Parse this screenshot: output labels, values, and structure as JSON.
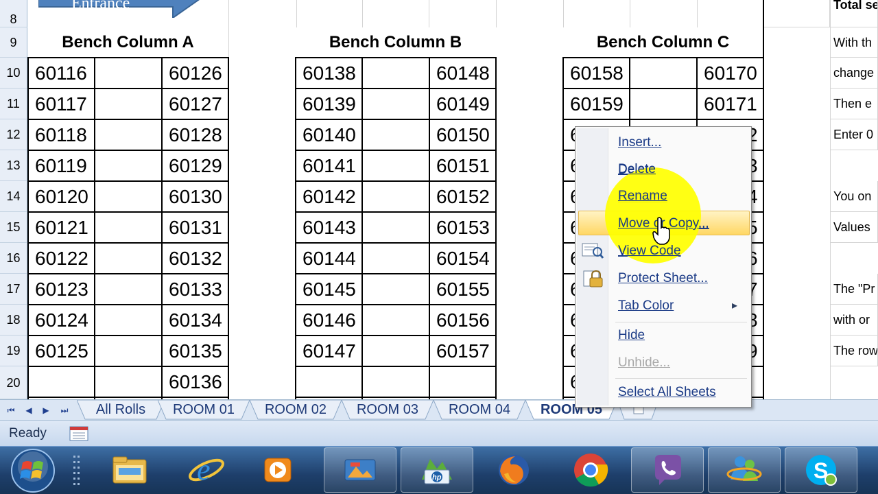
{
  "sheet": {
    "entrance_label": "Entrance",
    "row_numbers": [
      "8",
      "9",
      "10",
      "11",
      "12",
      "13",
      "14",
      "15",
      "16",
      "17",
      "18",
      "19",
      "20"
    ],
    "headers": {
      "a": "Bench Column A",
      "b": "Bench Column B",
      "c": "Bench Column C"
    },
    "col_a_left": [
      "60116",
      "60117",
      "60118",
      "60119",
      "60120",
      "60121",
      "60122",
      "60123",
      "60124",
      "60125",
      ""
    ],
    "col_a_right": [
      "60126",
      "60127",
      "60128",
      "60129",
      "60130",
      "60131",
      "60132",
      "60133",
      "60134",
      "60135",
      "60136"
    ],
    "col_b_left": [
      "60138",
      "60139",
      "60140",
      "60141",
      "60142",
      "60143",
      "60144",
      "60145",
      "60146",
      "60147",
      ""
    ],
    "col_b_right": [
      "60148",
      "60149",
      "60150",
      "60151",
      "60152",
      "60153",
      "60154",
      "60155",
      "60156",
      "60157",
      ""
    ],
    "col_c_left": [
      "60158",
      "60159",
      "6",
      "6",
      "6",
      "6",
      "6",
      "6",
      "6",
      "6",
      "6"
    ],
    "col_c_right": [
      "60170",
      "60171",
      "2",
      "3",
      "4",
      "5",
      "6",
      "7",
      "8",
      "9",
      ""
    ],
    "notes": {
      "r8": "Total se",
      "r9": "With th",
      "r10": "change",
      "r11": "Then e",
      "r12": "Enter 0",
      "r14": "You on",
      "r15": "Values",
      "r17": "The \"Pr",
      "r18": "with or",
      "r19": "The row"
    }
  },
  "tabs": {
    "nav": [
      "⏮",
      "◀",
      "▶",
      "⏭"
    ],
    "items": [
      "All Rolls",
      "ROOM 01",
      "ROOM 02",
      "ROOM 03",
      "ROOM 04",
      "ROOM 05"
    ],
    "active": "ROOM 05"
  },
  "status": {
    "text": "Ready"
  },
  "context_menu": {
    "items": [
      "Insert...",
      "Delete",
      "Rename",
      "Move or Copy...",
      "View Code",
      "Protect Sheet...",
      "Tab Color",
      "Hide",
      "Unhide...",
      "Select All Sheets"
    ],
    "highlighted": "Move or Copy...",
    "disabled": "Unhide...",
    "submenu_arrow": "▸"
  },
  "taskbar": {
    "apps": [
      "file-explorer-icon",
      "internet-explorer-icon",
      "media-player-icon",
      "photo-app-icon",
      "hp-icon",
      "firefox-icon",
      "chrome-icon",
      "viber-icon",
      "messenger-icon",
      "skype-icon"
    ]
  },
  "colors": {
    "accent_blue": "#4f81bd",
    "menu_highlight": "#ffd764",
    "yellow_spot": "#ffff00"
  }
}
